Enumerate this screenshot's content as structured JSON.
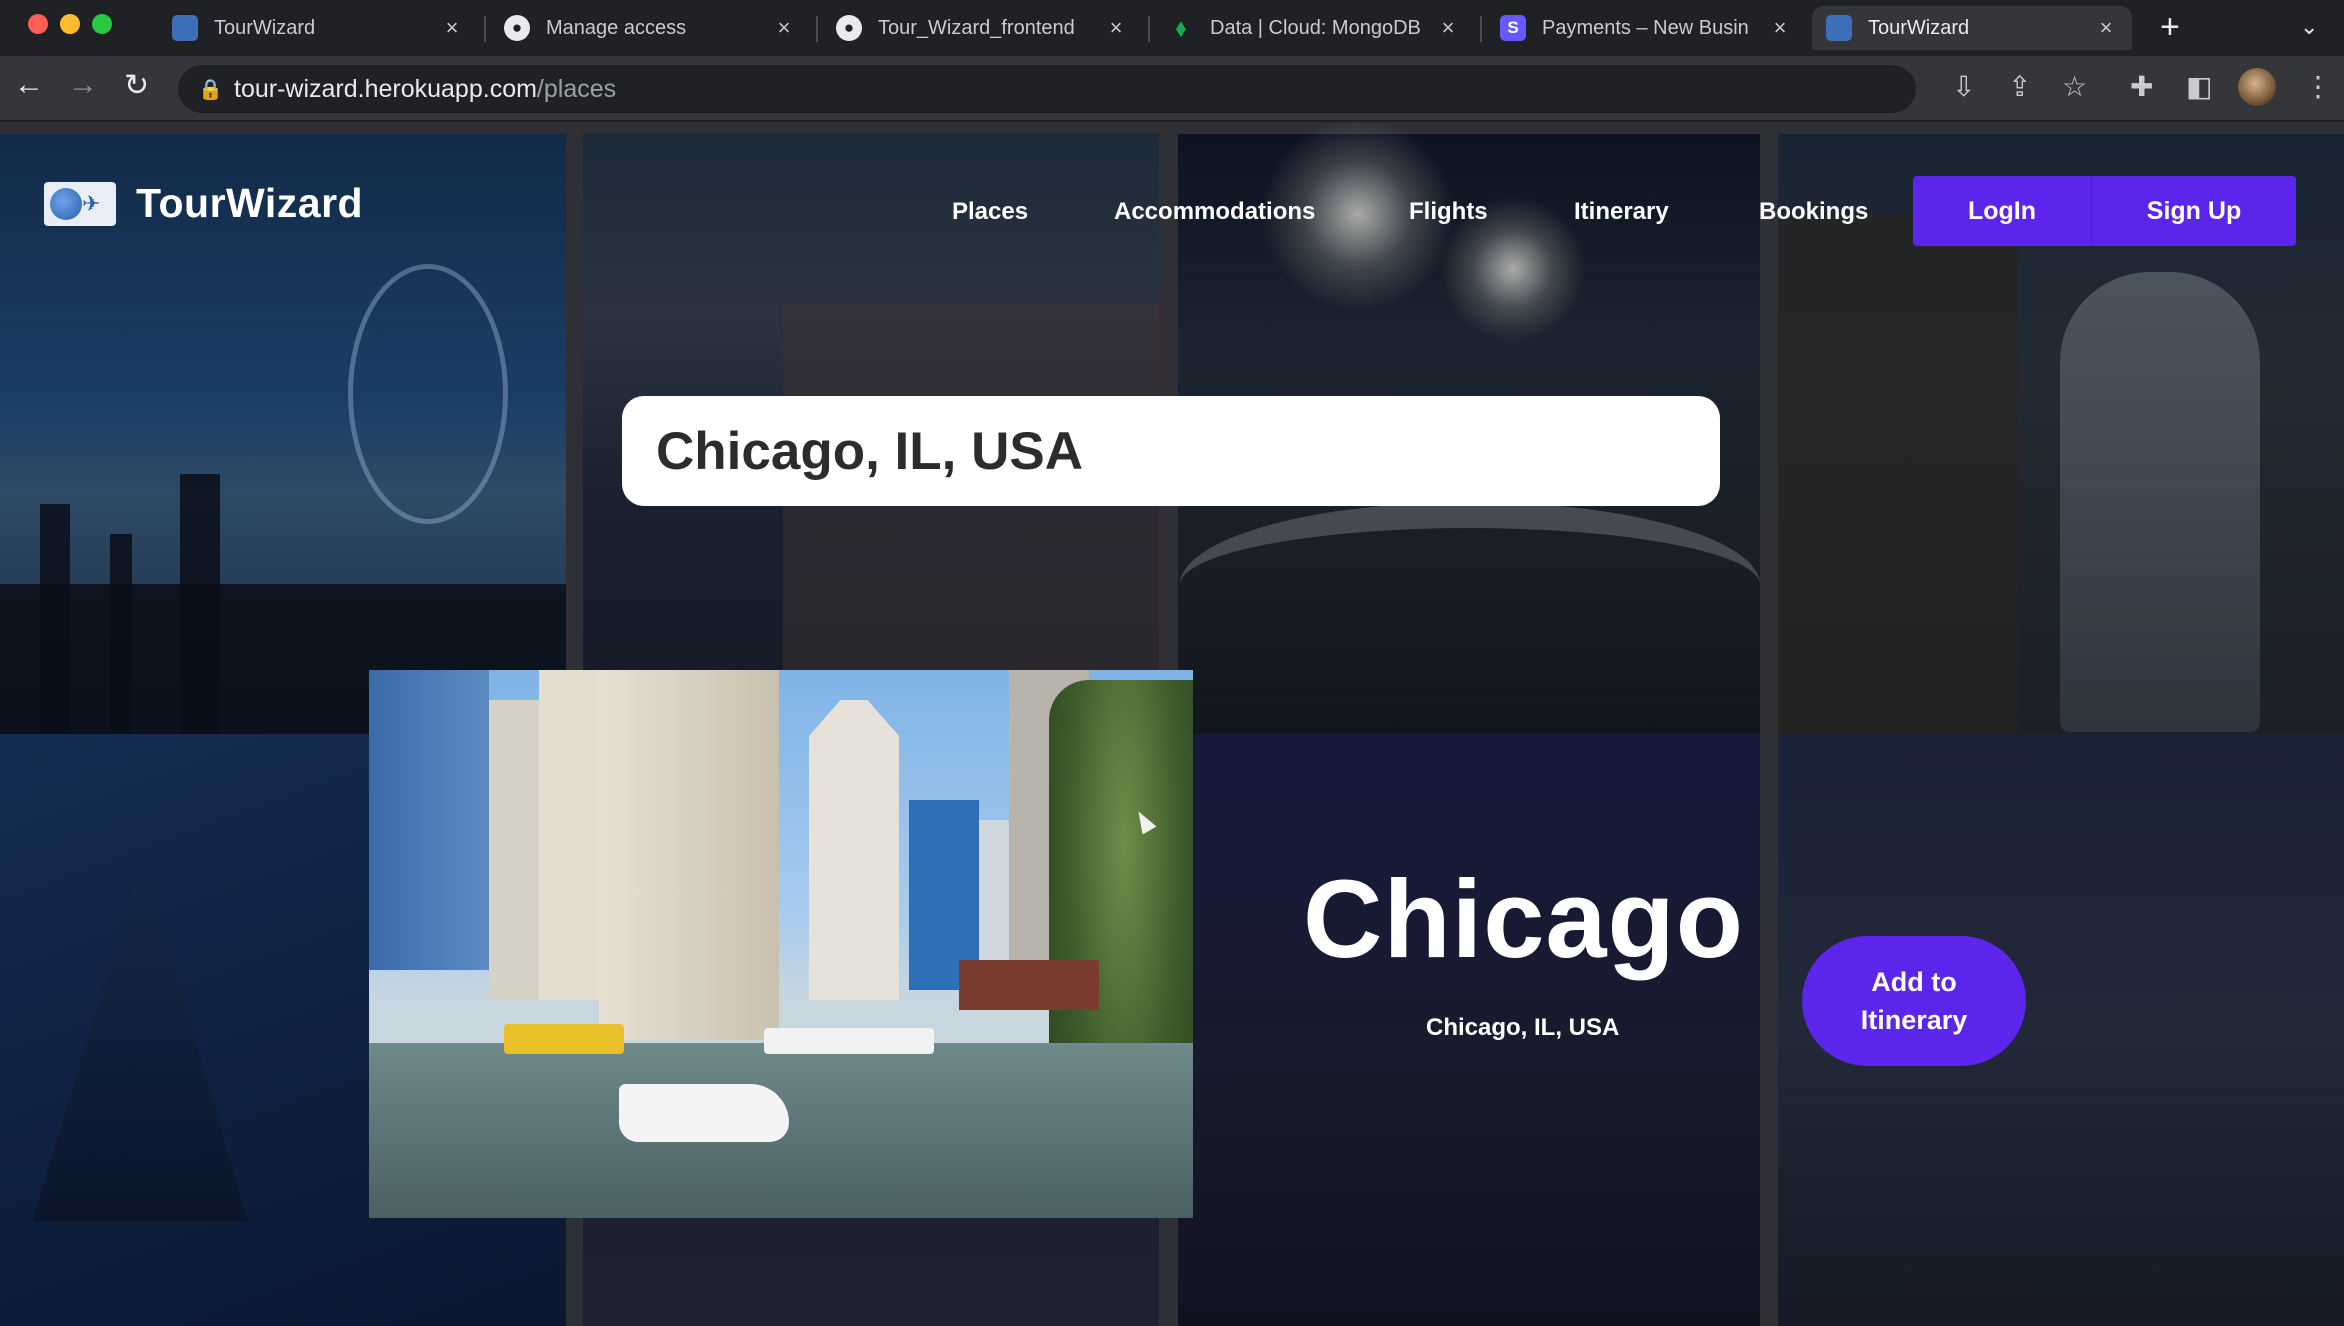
{
  "browser": {
    "tabs": [
      {
        "title": "TourWizard",
        "favicon": "tourwizard-favicon"
      },
      {
        "title": "Manage access",
        "favicon": "github-icon"
      },
      {
        "title": "Tour_Wizard_frontend",
        "favicon": "github-icon"
      },
      {
        "title": "Data | Cloud: MongoDB",
        "favicon": "mongodb-leaf-icon"
      },
      {
        "title": "Payments – New Busin",
        "favicon": "stripe-icon",
        "favicon_text": "S"
      },
      {
        "title": "TourWizard",
        "favicon": "tourwizard-favicon",
        "active": true
      }
    ],
    "address": {
      "host": "tour-wizard.herokuapp.com",
      "path": "/places"
    }
  },
  "nav": {
    "brand": "TourWizard",
    "links": [
      "Places",
      "Accommodations",
      "Flights",
      "Itinerary",
      "Bookings"
    ],
    "login_label": "LogIn",
    "signup_label": "Sign Up"
  },
  "search": {
    "value": "Chicago, IL, USA"
  },
  "place": {
    "name": "Chicago",
    "location": "Chicago, IL, USA",
    "add_button": "Add to Itinerary"
  },
  "colors": {
    "accent": "#5b25ec",
    "chrome_bg": "#35363a",
    "tab_bg": "#1f2124"
  }
}
